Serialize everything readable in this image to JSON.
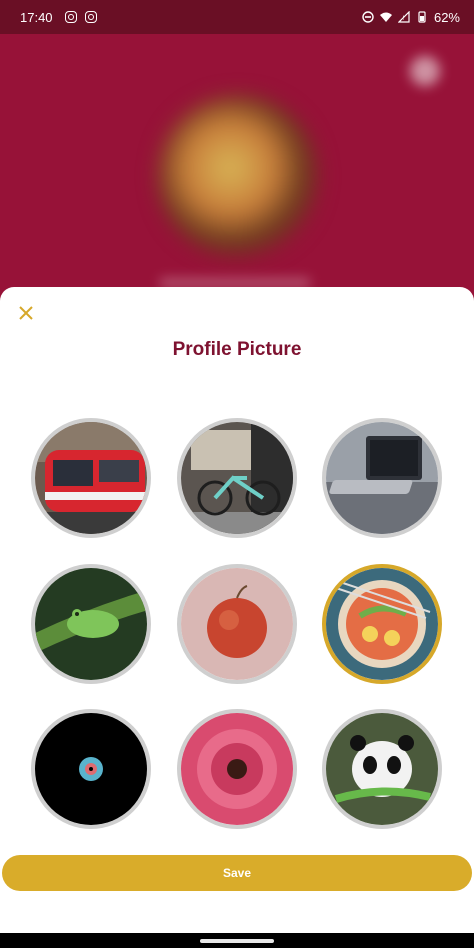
{
  "status_bar": {
    "time": "17:40",
    "battery": "62%",
    "icons": [
      "instagram-icon",
      "instagram-icon",
      "dnd-icon",
      "wifi-icon",
      "signal-icon",
      "battery-icon"
    ]
  },
  "sheet": {
    "title": "Profile Picture",
    "close_icon": "close-icon",
    "save_label": "Save",
    "selected_index": 5,
    "pictures": [
      {
        "name": "streetcar",
        "selected": false
      },
      {
        "name": "bicycle",
        "selected": false
      },
      {
        "name": "laptop",
        "selected": false
      },
      {
        "name": "frog",
        "selected": false
      },
      {
        "name": "apple",
        "selected": false
      },
      {
        "name": "ramen",
        "selected": true
      },
      {
        "name": "cd",
        "selected": false
      },
      {
        "name": "flower",
        "selected": false
      },
      {
        "name": "panda",
        "selected": false
      }
    ]
  },
  "colors": {
    "brand": "#971238",
    "title": "#7e1230",
    "accent": "#d9ac2a",
    "ring": "#cfcfcf"
  }
}
